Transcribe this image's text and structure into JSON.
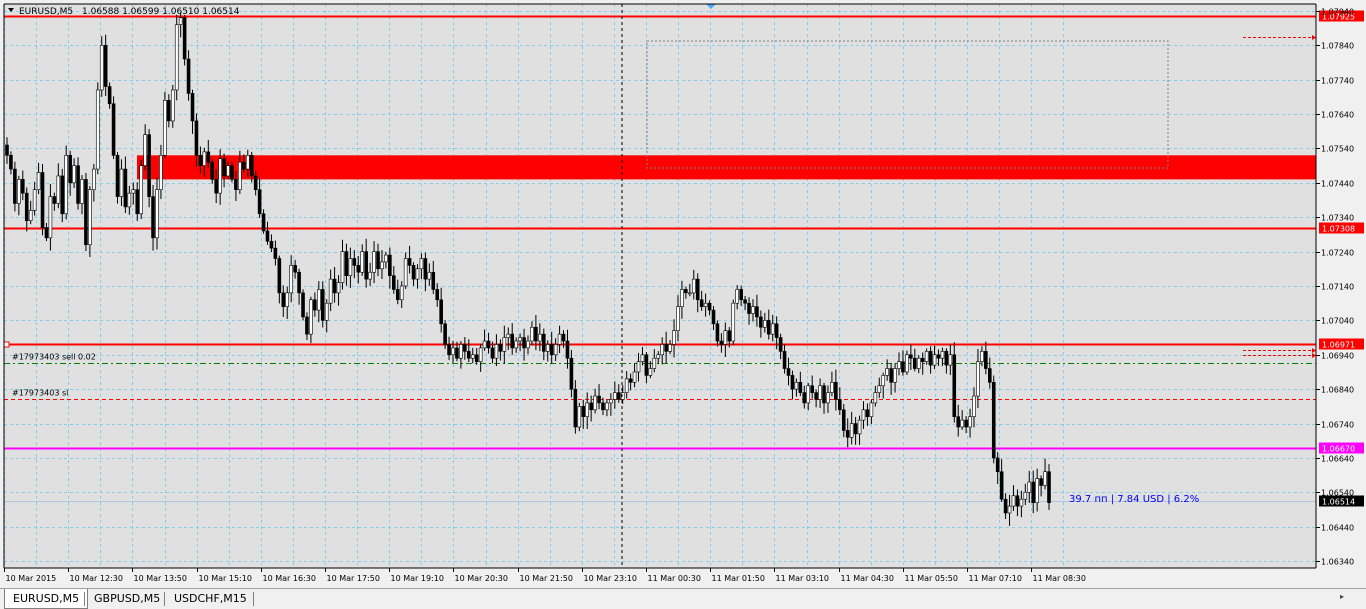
{
  "header": {
    "symbol_label": "EURUSD,M5",
    "ohlc": "1.06588 1.06599 1.06510 1.06514"
  },
  "price_axis": {
    "ticks": [
      "1.07940",
      "1.07840",
      "1.07740",
      "1.07640",
      "1.07540",
      "1.07440",
      "1.07340",
      "1.07240",
      "1.07140",
      "1.07040",
      "1.06940",
      "1.06840",
      "1.06740",
      "1.06640",
      "1.06540",
      "1.06440",
      "1.06340"
    ]
  },
  "time_axis": {
    "labels": [
      "10 Mar 2015",
      "10 Mar 12:30",
      "10 Mar 13:50",
      "10 Mar 15:10",
      "10 Mar 16:30",
      "10 Mar 17:50",
      "10 Mar 19:10",
      "10 Mar 20:30",
      "10 Mar 21:50",
      "10 Mar 23:10",
      "11 Mar 00:30",
      "11 Mar 01:50",
      "11 Mar 03:10",
      "11 Mar 04:30",
      "11 Mar 05:50",
      "11 Mar 07:10",
      "11 Mar 08:30"
    ]
  },
  "levels": [
    {
      "label": "1.07925",
      "price": 1.07925,
      "color": "#ff0000"
    },
    {
      "label": "1.07308",
      "price": 1.07308,
      "color": "#ff0000"
    },
    {
      "label": "1.06971",
      "price": 1.06971,
      "color": "#ff0000"
    },
    {
      "label": "1.06670",
      "price": 1.0667,
      "color": "#ff00ff"
    },
    {
      "label": "1.06514",
      "price": 1.06514,
      "color": "#000000"
    }
  ],
  "zone": {
    "low": 1.0745,
    "high": 1.0752,
    "color": "#ff0000"
  },
  "order_lines": [
    {
      "text": "#17973403 sell 0.02",
      "price": 1.06916,
      "color": "#008000"
    },
    {
      "text": "#17973403 sl",
      "price": 1.06812,
      "color": "#ff0000"
    }
  ],
  "profit_text": "39.7 пп | 7.84 USD | 6.2%",
  "tabs": [
    {
      "label": "EURUSD,M5",
      "active": true
    },
    {
      "label": "GBPUSD,M5",
      "active": false
    },
    {
      "label": "USDCHF,M15",
      "active": false
    }
  ],
  "colors": {
    "background": "#e0e0e0",
    "grid": "#87ceeb",
    "candle": "#000000",
    "accent_red": "#ff0000",
    "magenta": "#ff00ff",
    "profit_text": "#0000ff"
  },
  "chart_data": {
    "type": "candlestick",
    "title": "EURUSD,M5",
    "ylim": [
      1.0632,
      1.0796
    ],
    "series": [
      {
        "name": "EURUSD,M5",
        "close": [
          1.0752,
          1.0748,
          1.0738,
          1.0745,
          1.0741,
          1.0733,
          1.0736,
          1.0742,
          1.0747,
          1.0731,
          1.0728,
          1.074,
          1.0738,
          1.0746,
          1.0735,
          1.0752,
          1.0744,
          1.0749,
          1.0738,
          1.0745,
          1.0726,
          1.0742,
          1.0748,
          1.0771,
          1.0784,
          1.0772,
          1.0767,
          1.0752,
          1.074,
          1.0748,
          1.0737,
          1.0741,
          1.0742,
          1.0735,
          1.0749,
          1.0758,
          1.074,
          1.0728,
          1.0742,
          1.0752,
          1.0768,
          1.0762,
          1.0771,
          1.079,
          1.0792,
          1.078,
          1.077,
          1.0762,
          1.0752,
          1.0749,
          1.0753,
          1.075,
          1.0745,
          1.0741,
          1.0751,
          1.0746,
          1.0749,
          1.0745,
          1.0742,
          1.075,
          1.0748,
          1.0752,
          1.0746,
          1.0742,
          1.0735,
          1.073,
          1.0727,
          1.0725,
          1.0722,
          1.0712,
          1.0708,
          1.0712,
          1.072,
          1.0718,
          1.0712,
          1.0705,
          1.07,
          1.071,
          1.0707,
          1.0713,
          1.0704,
          1.0709,
          1.0716,
          1.0712,
          1.0715,
          1.0724,
          1.0717,
          1.0722,
          1.072,
          1.0718,
          1.0724,
          1.0716,
          1.0718,
          1.0724,
          1.0719,
          1.0721,
          1.0723,
          1.0717,
          1.0713,
          1.071,
          1.0714,
          1.0722,
          1.072,
          1.0716,
          1.0719,
          1.0722,
          1.0716,
          1.0718,
          1.0713,
          1.071,
          1.0703,
          1.0697,
          1.0694,
          1.0696,
          1.0693,
          1.0697,
          1.0695,
          1.0693,
          1.0694,
          1.0692,
          1.0696,
          1.0698,
          1.0696,
          1.0693,
          1.0697,
          1.0695,
          1.0699,
          1.07,
          1.0696,
          1.0698,
          1.0699,
          1.0696,
          1.0698,
          1.0702,
          1.0698,
          1.07,
          1.0695,
          1.0697,
          1.0694,
          1.0697,
          1.07,
          1.0698,
          1.0693,
          1.0684,
          1.0673,
          1.0679,
          1.0676,
          1.068,
          1.0678,
          1.0682,
          1.068,
          1.0678,
          1.068,
          1.0681,
          1.0683,
          1.0681,
          1.0683,
          1.0687,
          1.0686,
          1.0689,
          1.0692,
          1.0694,
          1.0688,
          1.069,
          1.0693,
          1.0694,
          1.0697,
          1.0695,
          1.0697,
          1.0701,
          1.0708,
          1.0713,
          1.0712,
          1.0712,
          1.0716,
          1.071,
          1.0708,
          1.0709,
          1.0707,
          1.0703,
          1.0698,
          1.0697,
          1.0701,
          1.0698,
          1.0709,
          1.0713,
          1.071,
          1.0709,
          1.0706,
          1.0708,
          1.0705,
          1.0702,
          1.0704,
          1.07,
          1.0703,
          1.0699,
          1.0695,
          1.069,
          1.0688,
          1.0684,
          1.0686,
          1.0683,
          1.068,
          1.0685,
          1.0683,
          1.0681,
          1.0685,
          1.068,
          1.0683,
          1.0686,
          1.0681,
          1.0678,
          1.0672,
          1.067,
          1.0674,
          1.0671,
          1.0675,
          1.0678,
          1.0676,
          1.068,
          1.0683,
          1.0685,
          1.0688,
          1.069,
          1.0686,
          1.069,
          1.0692,
          1.0689,
          1.0694,
          1.0693,
          1.069,
          1.0693,
          1.0692,
          1.0695,
          1.0691,
          1.0694,
          1.0693,
          1.0695,
          1.0691,
          1.0694,
          1.0676,
          1.0673,
          1.0675,
          1.0673,
          1.0676,
          1.0682,
          1.0692,
          1.0695,
          1.069,
          1.0686,
          1.0664,
          1.066,
          1.0652,
          1.0648,
          1.065,
          1.0653,
          1.065,
          1.0652,
          1.0654,
          1.0657,
          1.0651,
          1.0658,
          1.0656,
          1.066,
          1.0651
        ]
      }
    ]
  }
}
